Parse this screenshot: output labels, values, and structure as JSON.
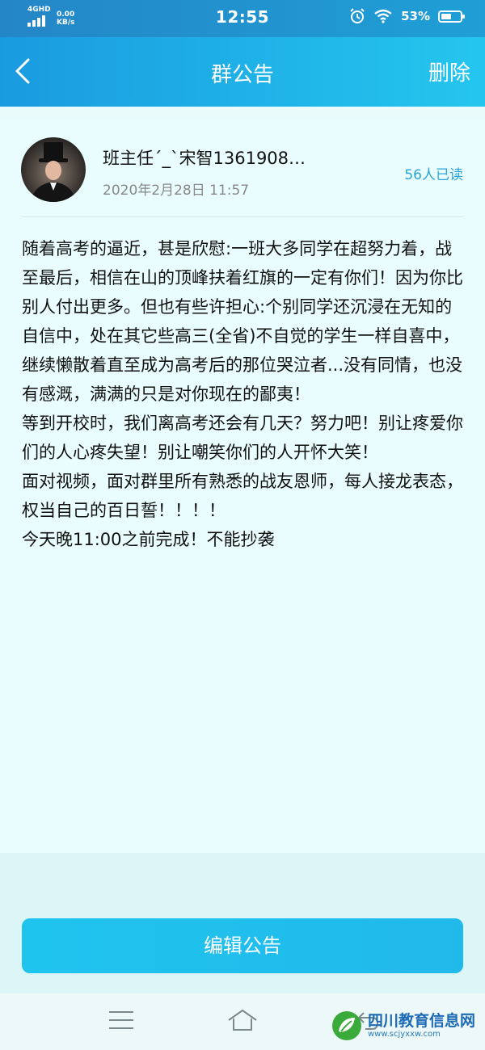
{
  "status_bar": {
    "network": "4GHD",
    "speed_value": "0.00",
    "speed_unit": "KB/s",
    "time": "12:55",
    "battery_percent": "53%",
    "battery_level": 0.53
  },
  "header": {
    "title": "群公告",
    "delete_label": "删除"
  },
  "notice": {
    "author": "班主任´_`宋智1361908…",
    "date": "2020年2月28日 11:57",
    "read_count": "56人已读",
    "paragraphs": [
      "随着高考的逼近，甚是欣慰:一班大多同学在超努力着，战至最后，相信在山的顶峰扶着红旗的一定有你们！因为你比别人付出更多。但也有些许担心:个别同学还沉浸在无知的自信中，处在其它些高三(全省)不自觉的学生一样自喜中，继续懒散着直至成为高考后的那位哭泣者...没有同情，也没有感溉，满满的只是对你现在的鄙夷！",
      "等到开校时，我们离高考还会有几天？努力吧！别让疼爱你们的人心疼失望！别让嘲笑你们的人开怀大笑！",
      "面对视频，面对群里所有熟悉的战友恩师，每人接龙表态，权当自己的百日誓！！！！",
      "今天晚11:00之前完成！不能抄袭"
    ]
  },
  "edit_button_label": "编辑公告",
  "watermark": {
    "title": "四川教育信息网",
    "url": "www.scjyxxw.com"
  },
  "colors": {
    "header_start": "#1a9be0",
    "header_end": "#24c6ee",
    "accent": "#21b9ea",
    "read_count": "#2aa4d6"
  },
  "icons": [
    "back-arrow-icon",
    "menu-icon",
    "home-icon",
    "nav-back-icon",
    "alarm-icon",
    "wifi-icon",
    "battery-icon",
    "signal-icon"
  ]
}
